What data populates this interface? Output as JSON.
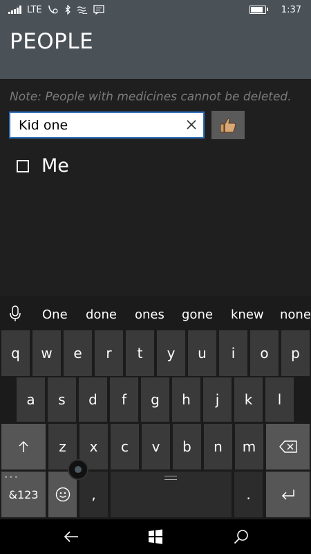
{
  "status_bar": {
    "network": "LTE",
    "time": "1:37",
    "battery_level": 0.8
  },
  "header": {
    "title": "PEOPLE"
  },
  "main": {
    "note": "Note: People with medicines cannot be deleted.",
    "name_input": {
      "value": "Kid one",
      "placeholder": ""
    },
    "people": [
      {
        "name": "Me",
        "checked": false
      }
    ]
  },
  "keyboard": {
    "suggestions": [
      "One",
      "done",
      "ones",
      "gone",
      "knew",
      "none"
    ],
    "row1": [
      "q",
      "w",
      "e",
      "r",
      "t",
      "y",
      "u",
      "i",
      "o",
      "p"
    ],
    "row2": [
      "a",
      "s",
      "d",
      "f",
      "g",
      "h",
      "j",
      "k",
      "l"
    ],
    "row3": [
      "z",
      "x",
      "c",
      "v",
      "b",
      "n",
      "m"
    ],
    "symbols_label": "&123",
    "comma_label": ",",
    "period_label": "."
  },
  "colors": {
    "header_bg": "#4a5157",
    "accent": "#2e6fb8",
    "background": "#1f1f1f"
  }
}
